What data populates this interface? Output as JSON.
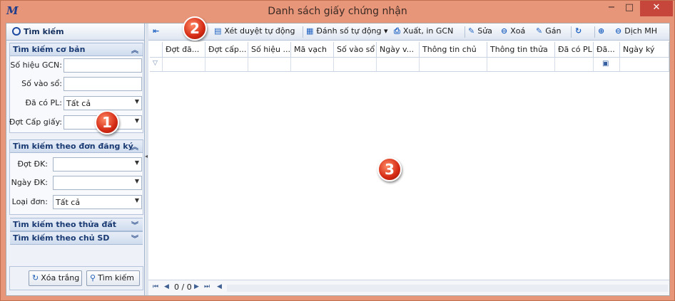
{
  "window": {
    "title": "Danh sách giấy chứng nhận",
    "minimize": "−",
    "maximize": "□",
    "close": "✕"
  },
  "left_panel": {
    "header": "Tìm kiếm",
    "section_basic": "Tìm kiếm cơ bản",
    "fields_basic": [
      {
        "label": "Số hiệu GCN:",
        "value": ""
      },
      {
        "label": "Số vào sổ:",
        "value": ""
      },
      {
        "label": "Đã có PL:",
        "value": "Tất cả"
      },
      {
        "label": "Đợt Cấp giấy:",
        "value": ""
      }
    ],
    "section_dk": "Tìm kiếm theo đơn đăng ký",
    "fields_dk": [
      {
        "label": "Đợt ĐK:",
        "value": ""
      },
      {
        "label": "Ngày ĐK:",
        "value": ""
      },
      {
        "label": "Loại đơn:",
        "value": "Tất cả"
      }
    ],
    "section_land": "Tìm kiếm theo thửa đất",
    "section_owner": "Tìm kiếm theo chủ SD",
    "btn_clear": "Xóa trắng",
    "btn_search": "Tìm kiếm"
  },
  "toolbar": {
    "review": "Xét duyệt tự động",
    "numbering": "Đánh số tự động",
    "export": "Xuất, in GCN",
    "edit": "Sửa",
    "delete": "Xoá",
    "assign": "Gán",
    "move": "Dịch MH"
  },
  "grid": {
    "columns": [
      "Đợt đă...",
      "Đợt cấp...",
      "Số hiệu ...",
      "Mã vạch",
      "Số vào sổ",
      "Ngày v...",
      "Thông tin chủ",
      "Thông tin thửa",
      "Đã có PL",
      "Đã...",
      "Ngày ký"
    ]
  },
  "pager": {
    "text": "0 / 0"
  },
  "badges": [
    "1",
    "2",
    "3"
  ]
}
